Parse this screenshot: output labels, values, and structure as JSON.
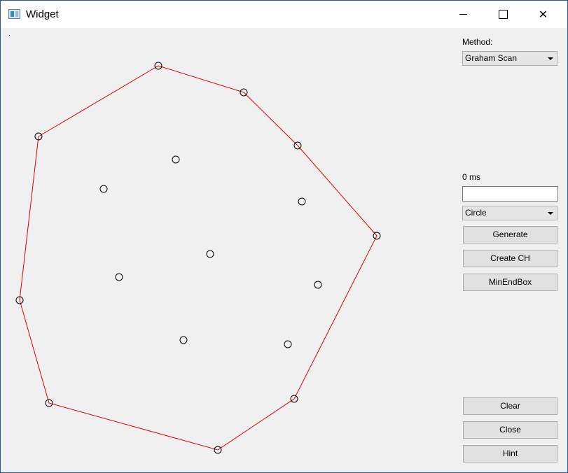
{
  "window": {
    "title": "Widget",
    "minimize_glyph": "",
    "maximize_glyph": "",
    "close_glyph": "✕"
  },
  "panel": {
    "method_label": "Method:",
    "method_value": "Graham Scan",
    "time_label": "0 ms",
    "input_value": "",
    "shape_value": "Circle",
    "generate_label": "Generate",
    "create_ch_label": "Create CH",
    "minendbox_label": "MinEndBox",
    "clear_label": "Clear",
    "close_label": "Close",
    "hint_label": "Hint"
  },
  "canvas": {
    "hull_color": "#e00000",
    "point_color": "#000000"
  }
}
